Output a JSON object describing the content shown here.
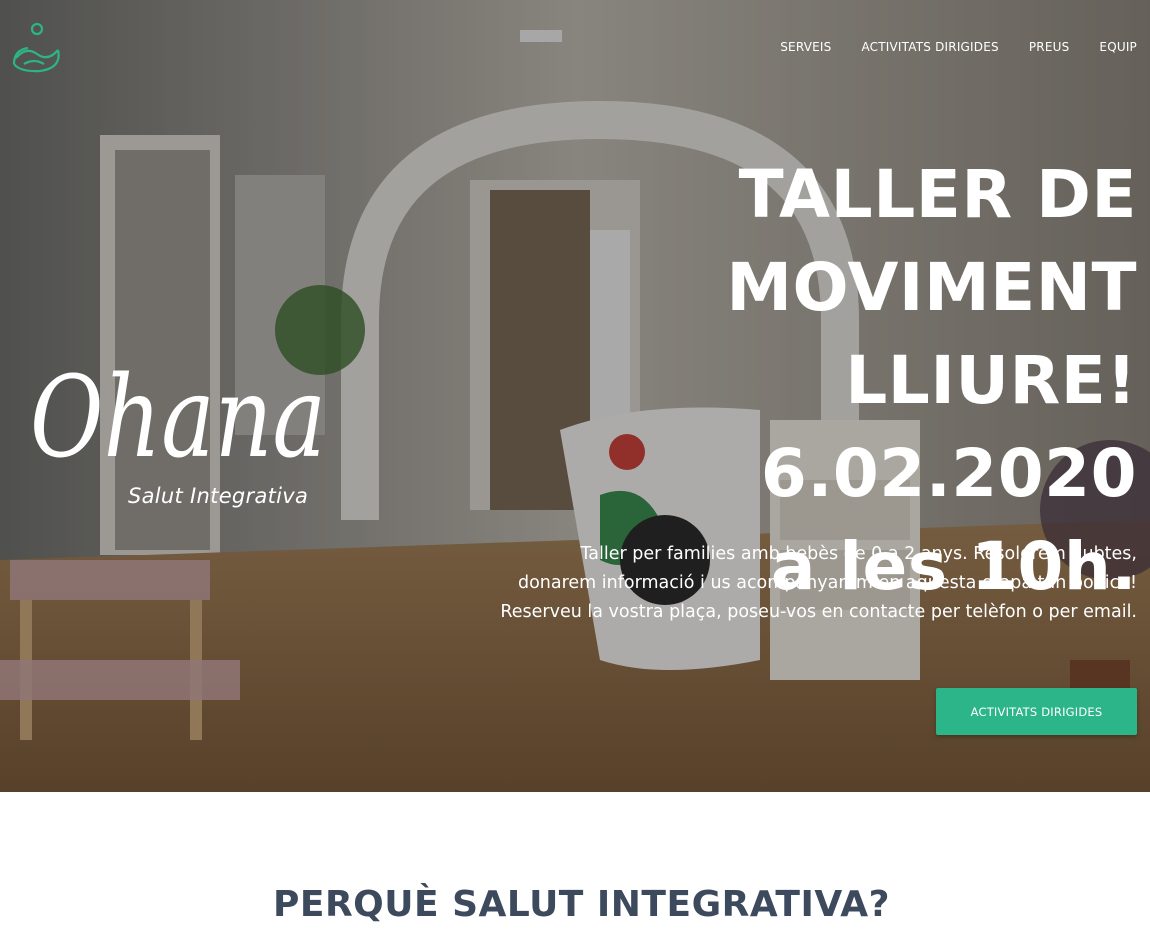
{
  "nav": {
    "items": [
      {
        "label": "SERVEIS"
      },
      {
        "label": "ACTIVITATS DIRIGIDES"
      },
      {
        "label": "PREUS"
      },
      {
        "label": "EQUIP"
      }
    ]
  },
  "brand": {
    "logo_text": "Ohana",
    "logo_subtitle": "Salut Integrativa",
    "accent_color": "#2bb589"
  },
  "hero": {
    "headline_lines": [
      "TALLER DE",
      "MOVIMENT",
      "LLIURE! 6.02.2020",
      "a les 10h."
    ],
    "body_lines": [
      "Taller per families amb bebès de 0 a 2 anys. Resoldrem dubtes,",
      "donarem informació i us acompanyarem en aquesta etapa tan bonica!",
      "Reserveu la vostra plaça, poseu-vos en contacte per telèfon o per email."
    ],
    "cta_label": "ACTIVITATS DIRIGIDES"
  },
  "section": {
    "title": "PERQUÈ SALUT INTEGRATIVA?",
    "title_color": "#3d4a5d"
  }
}
